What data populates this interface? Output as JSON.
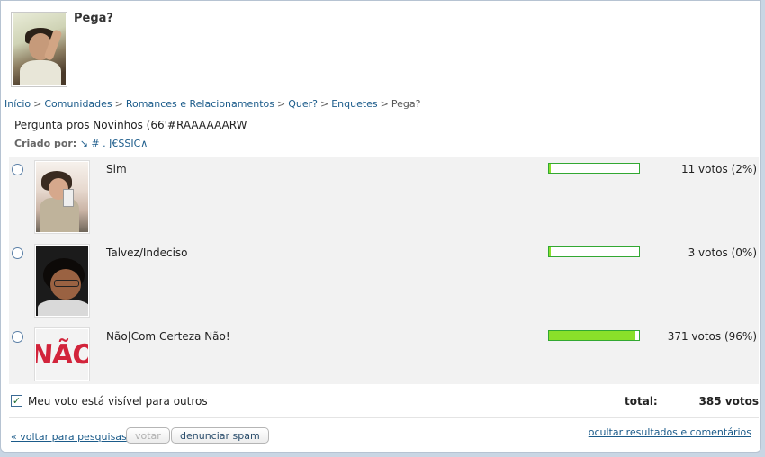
{
  "page": {
    "title": "Pega?"
  },
  "breadcrumb": [
    {
      "label": "Início"
    },
    {
      "label": "Comunidades"
    },
    {
      "label": "Romances e Relacionamentos"
    },
    {
      "label": "Quer?"
    },
    {
      "label": "Enquetes"
    },
    {
      "label": "Pega?"
    }
  ],
  "poll": {
    "question": "Pergunta pros Novinhos (66'#RAAAAAARW",
    "creator_prefix": "Criado por:",
    "creator_name": "↘ # . J€SSIC∧",
    "options": [
      {
        "label": "Sim",
        "votes_text": "11 votos (2%)",
        "percent": 2
      },
      {
        "label": "Talvez/Indeciso",
        "votes_text": "3 votos (0%)",
        "percent": 0
      },
      {
        "label": "Não|Com Certeza Não!",
        "votes_text": "371 votos (96%)",
        "percent": 96,
        "image_text": "NÃO"
      }
    ],
    "visibility_label": "Meu voto está visível para outros",
    "visibility_checked": true,
    "total_label": "total:",
    "total_value": "385 votos"
  },
  "actions": {
    "back_label": "« voltar para pesquisas",
    "vote_label": "votar",
    "spam_label": "denunciar spam",
    "hide_label": "ocultar resultados e comentários"
  },
  "colors": {
    "bar_fill": "#8ae02a",
    "bar_border": "#32a832",
    "link": "#1b5b8a",
    "poll_bg": "#f2f2f2"
  }
}
